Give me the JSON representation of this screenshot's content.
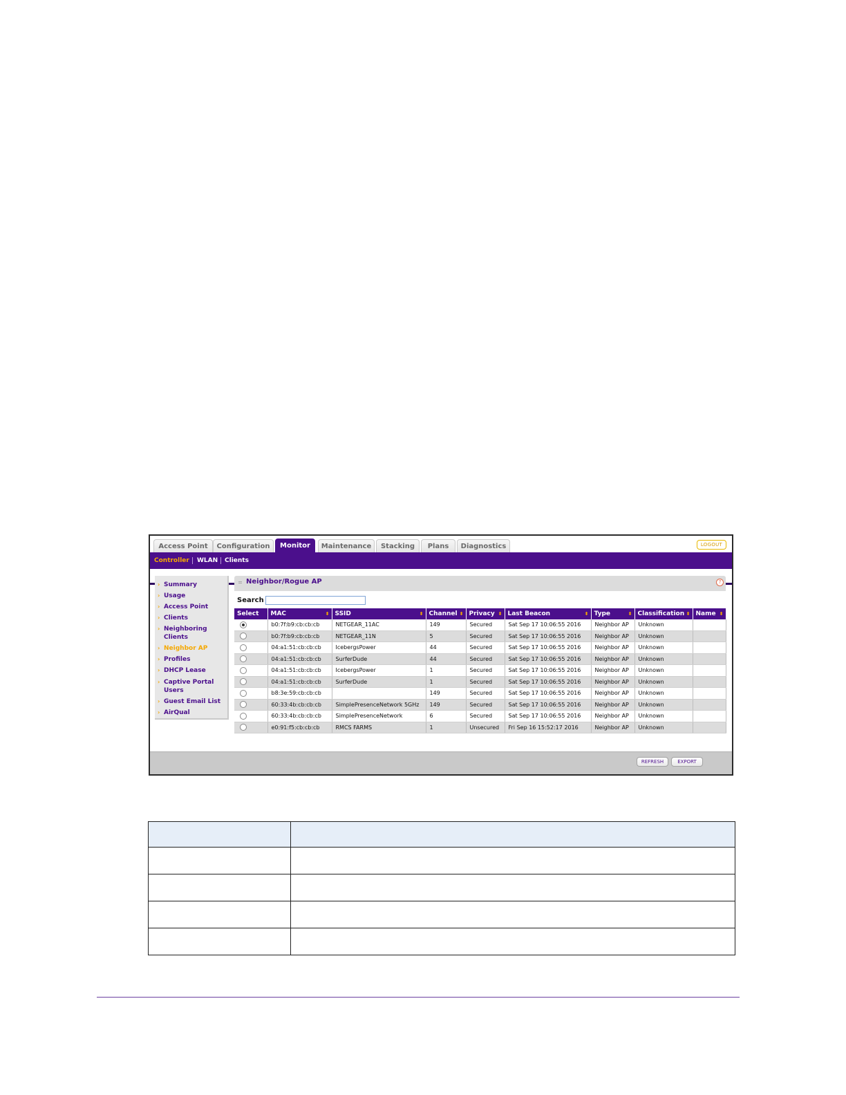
{
  "tabs": [
    {
      "label": "Access Point",
      "active": false
    },
    {
      "label": "Configuration",
      "active": false
    },
    {
      "label": "Monitor",
      "active": true
    },
    {
      "label": "Maintenance",
      "active": false
    },
    {
      "label": "Stacking",
      "active": false
    },
    {
      "label": "Plans",
      "active": false
    },
    {
      "label": "Diagnostics",
      "active": false
    }
  ],
  "logout_label": "LOGOUT",
  "subnav": [
    {
      "label": "Controller",
      "active": true
    },
    {
      "label": "WLAN",
      "active": false
    },
    {
      "label": "Clients",
      "active": false
    }
  ],
  "sidebar": [
    {
      "label": "Summary",
      "active": false
    },
    {
      "label": "Usage",
      "active": false
    },
    {
      "label": "Access Point",
      "active": false
    },
    {
      "label": "Clients",
      "active": false
    },
    {
      "label": "Neighboring Clients",
      "active": false
    },
    {
      "label": "Neighbor AP",
      "active": true
    },
    {
      "label": "Profiles",
      "active": false
    },
    {
      "label": "DHCP Lease",
      "active": false
    },
    {
      "label": "Captive Portal Users",
      "active": false
    },
    {
      "label": "Guest Email List",
      "active": false
    },
    {
      "label": "AirQual",
      "active": false
    }
  ],
  "panel": {
    "title": "Neighbor/Rogue AP",
    "search_label": "Search",
    "search_value": ""
  },
  "table": {
    "columns": [
      "Select",
      "MAC",
      "SSID",
      "Channel",
      "Privacy",
      "Last Beacon",
      "Type",
      "Classification",
      "Name"
    ],
    "rows": [
      {
        "selected": true,
        "mac": "b0:7f:b9:cb:cb:cb",
        "ssid": "NETGEAR_11AC",
        "channel": "149",
        "privacy": "Secured",
        "last_beacon": "Sat Sep 17 10:06:55 2016",
        "type": "Neighbor AP",
        "classification": "Unknown",
        "name": ""
      },
      {
        "selected": false,
        "mac": "b0:7f:b9:cb:cb:cb",
        "ssid": "NETGEAR_11N",
        "channel": "5",
        "privacy": "Secured",
        "last_beacon": "Sat Sep 17 10:06:55 2016",
        "type": "Neighbor AP",
        "classification": "Unknown",
        "name": ""
      },
      {
        "selected": false,
        "mac": "04:a1:51:cb:cb:cb",
        "ssid": "IcebergsPower",
        "channel": "44",
        "privacy": "Secured",
        "last_beacon": "Sat Sep 17 10:06:55 2016",
        "type": "Neighbor AP",
        "classification": "Unknown",
        "name": ""
      },
      {
        "selected": false,
        "mac": "04:a1:51:cb:cb:cb",
        "ssid": "SurferDude",
        "channel": "44",
        "privacy": "Secured",
        "last_beacon": "Sat Sep 17 10:06:55 2016",
        "type": "Neighbor AP",
        "classification": "Unknown",
        "name": ""
      },
      {
        "selected": false,
        "mac": "04:a1:51:cb:cb:cb",
        "ssid": "IcebergsPower",
        "channel": "1",
        "privacy": "Secured",
        "last_beacon": "Sat Sep 17 10:06:55 2016",
        "type": "Neighbor AP",
        "classification": "Unknown",
        "name": ""
      },
      {
        "selected": false,
        "mac": "04:a1:51:cb:cb:cb",
        "ssid": "SurferDude",
        "channel": "1",
        "privacy": "Secured",
        "last_beacon": "Sat Sep 17 10:06:55 2016",
        "type": "Neighbor AP",
        "classification": "Unknown",
        "name": ""
      },
      {
        "selected": false,
        "mac": "b8:3e:59:cb:cb:cb",
        "ssid": "",
        "channel": "149",
        "privacy": "Secured",
        "last_beacon": "Sat Sep 17 10:06:55 2016",
        "type": "Neighbor AP",
        "classification": "Unknown",
        "name": ""
      },
      {
        "selected": false,
        "mac": "60:33:4b:cb:cb:cb",
        "ssid": "SimplePresenceNetwork 5GHz",
        "channel": "149",
        "privacy": "Secured",
        "last_beacon": "Sat Sep 17 10:06:55 2016",
        "type": "Neighbor AP",
        "classification": "Unknown",
        "name": ""
      },
      {
        "selected": false,
        "mac": "60:33:4b:cb:cb:cb",
        "ssid": "SimplePresenceNetwork",
        "channel": "6",
        "privacy": "Secured",
        "last_beacon": "Sat Sep 17 10:06:55 2016",
        "type": "Neighbor AP",
        "classification": "Unknown",
        "name": ""
      },
      {
        "selected": false,
        "mac": "e0:91:f5:cb:cb:cb",
        "ssid": "RMCS FARMS",
        "channel": "1",
        "privacy": "Unsecured",
        "last_beacon": "Fri Sep 16 15:52:17 2016",
        "type": "Neighbor AP",
        "classification": "Unknown",
        "name": ""
      }
    ]
  },
  "buttons": {
    "refresh": "REFRESH",
    "export": "EXPORT"
  },
  "icons": {
    "help": "help-icon",
    "sort": "sort-arrows-icon",
    "sidebar_bullet": "chevron-right-icon"
  },
  "colors": {
    "brand_purple": "#4b0f8c",
    "accent_orange": "#f5a800",
    "row_alt": "#dcdcdc"
  }
}
